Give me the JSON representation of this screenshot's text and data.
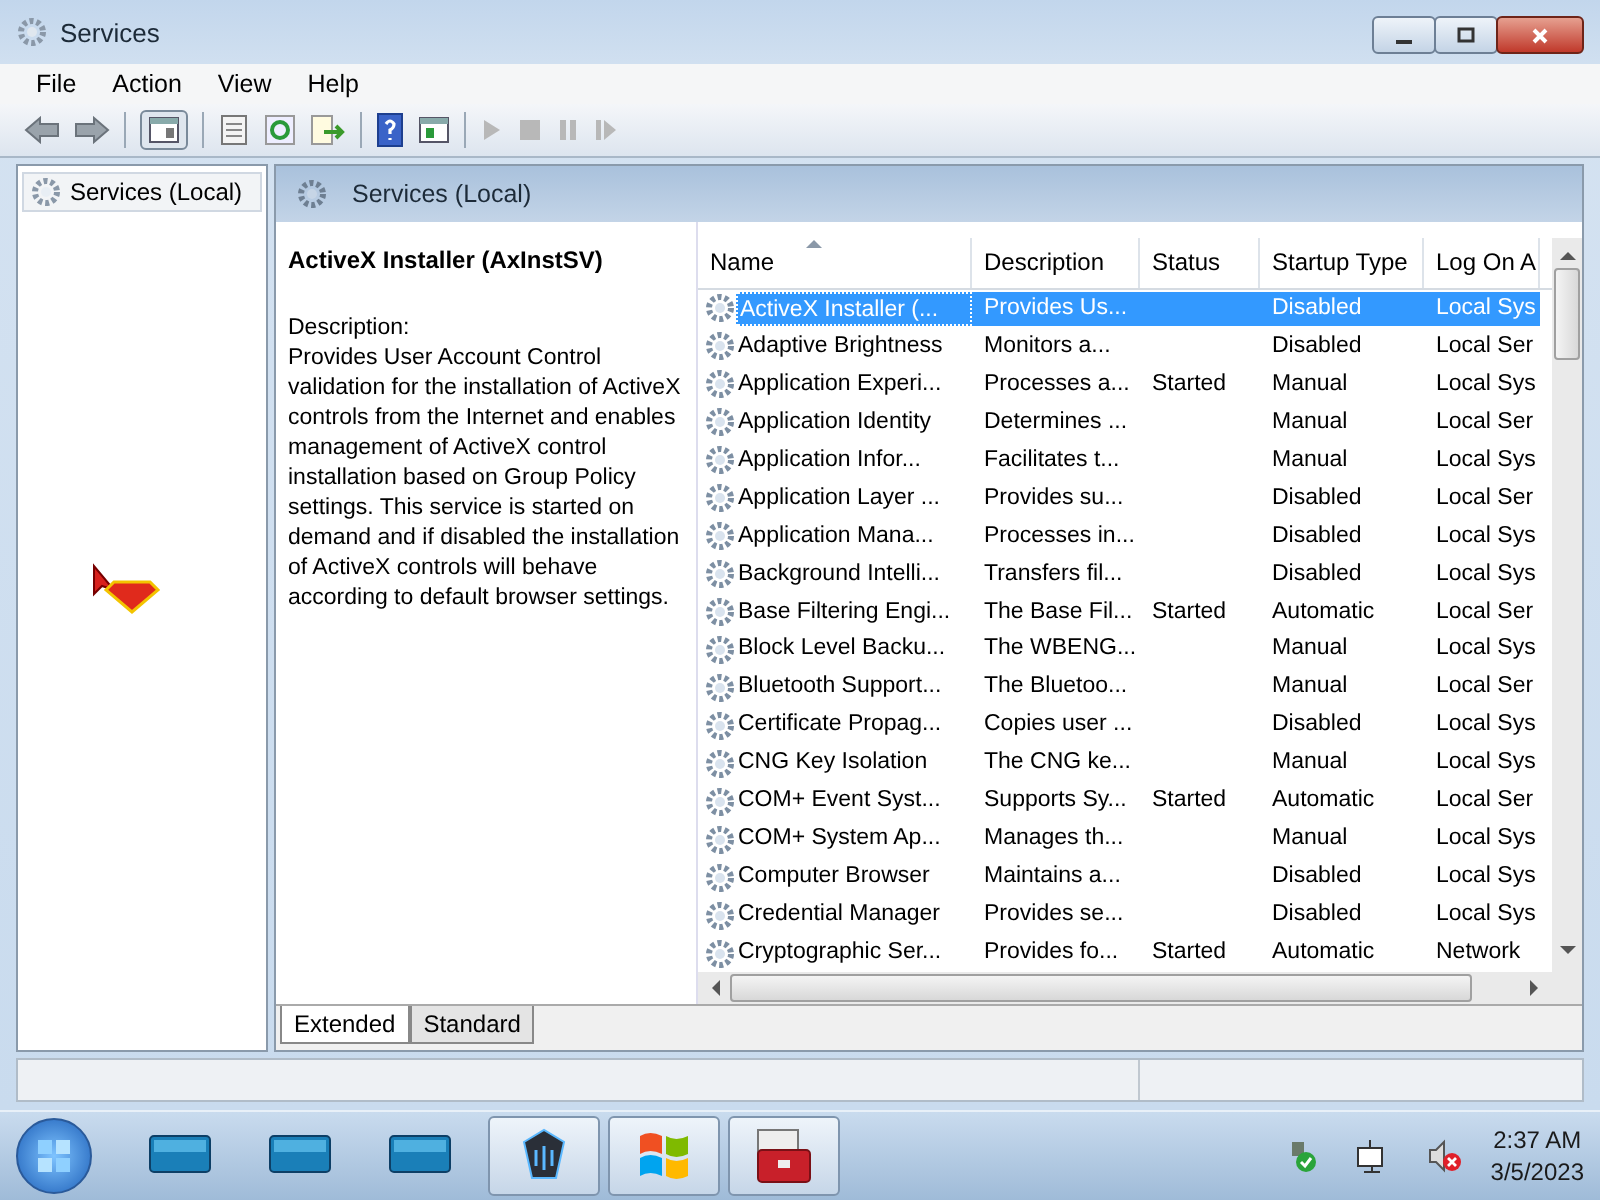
{
  "window": {
    "title": "Services"
  },
  "menu": [
    "File",
    "Action",
    "View",
    "Help"
  ],
  "tree": {
    "items": [
      {
        "label": "Services (Local)",
        "selected": true
      }
    ]
  },
  "header": {
    "title": "Services (Local)"
  },
  "detail": {
    "title": "ActiveX Installer (AxInstSV)",
    "description_label": "Description:",
    "description": "Provides User Account Control validation for the installation of ActiveX controls from the Internet and enables management of ActiveX control installation based on Group Policy settings. This service is started on demand and if disabled the installation of ActiveX controls will behave according to default browser settings."
  },
  "table": {
    "columns": [
      {
        "label": "Name",
        "sorted": true
      },
      {
        "label": "Description",
        "sorted": false
      },
      {
        "label": "Status",
        "sorted": false
      },
      {
        "label": "Startup Type",
        "sorted": false
      },
      {
        "label": "Log On A",
        "sorted": false
      }
    ],
    "rows": [
      {
        "name": "ActiveX Installer (...",
        "description": "Provides Us...",
        "status": "",
        "startup_type": "Disabled",
        "log_on_as": "Local Sys",
        "selected": true
      },
      {
        "name": "Adaptive Brightness",
        "description": "Monitors a...",
        "status": "",
        "startup_type": "Disabled",
        "log_on_as": "Local Ser",
        "selected": false
      },
      {
        "name": "Application Experi...",
        "description": "Processes a...",
        "status": "Started",
        "startup_type": "Manual",
        "log_on_as": "Local Sys",
        "selected": false
      },
      {
        "name": "Application Identity",
        "description": "Determines ...",
        "status": "",
        "startup_type": "Manual",
        "log_on_as": "Local Ser",
        "selected": false
      },
      {
        "name": "Application Infor...",
        "description": "Facilitates t...",
        "status": "",
        "startup_type": "Manual",
        "log_on_as": "Local Sys",
        "selected": false
      },
      {
        "name": "Application Layer ...",
        "description": "Provides su...",
        "status": "",
        "startup_type": "Disabled",
        "log_on_as": "Local Ser",
        "selected": false
      },
      {
        "name": "Application Mana...",
        "description": "Processes in...",
        "status": "",
        "startup_type": "Disabled",
        "log_on_as": "Local Sys",
        "selected": false
      },
      {
        "name": "Background Intelli...",
        "description": "Transfers fil...",
        "status": "",
        "startup_type": "Disabled",
        "log_on_as": "Local Sys",
        "selected": false
      },
      {
        "name": "Base Filtering Engi...",
        "description": "The Base Fil...",
        "status": "Started",
        "startup_type": "Automatic",
        "log_on_as": "Local Ser",
        "selected": false
      },
      {
        "name": "Block Level Backu...",
        "description": "The WBENG...",
        "status": "",
        "startup_type": "Manual",
        "log_on_as": "Local Sys",
        "selected": false
      },
      {
        "name": "Bluetooth Support...",
        "description": "The Bluetoo...",
        "status": "",
        "startup_type": "Manual",
        "log_on_as": "Local Ser",
        "selected": false
      },
      {
        "name": "Certificate Propag...",
        "description": "Copies user ...",
        "status": "",
        "startup_type": "Disabled",
        "log_on_as": "Local Sys",
        "selected": false
      },
      {
        "name": "CNG Key Isolation",
        "description": "The CNG ke...",
        "status": "",
        "startup_type": "Manual",
        "log_on_as": "Local Sys",
        "selected": false
      },
      {
        "name": "COM+ Event Syst...",
        "description": "Supports Sy...",
        "status": "Started",
        "startup_type": "Automatic",
        "log_on_as": "Local Ser",
        "selected": false
      },
      {
        "name": "COM+ System Ap...",
        "description": "Manages th...",
        "status": "",
        "startup_type": "Manual",
        "log_on_as": "Local Sys",
        "selected": false
      },
      {
        "name": "Computer Browser",
        "description": "Maintains a...",
        "status": "",
        "startup_type": "Disabled",
        "log_on_as": "Local Sys",
        "selected": false
      },
      {
        "name": "Credential Manager",
        "description": "Provides se...",
        "status": "",
        "startup_type": "Disabled",
        "log_on_as": "Local Sys",
        "selected": false
      },
      {
        "name": "Cryptographic Ser...",
        "description": "Provides fo...",
        "status": "Started",
        "startup_type": "Automatic",
        "log_on_as": "Network",
        "selected": false
      }
    ]
  },
  "view_tabs": [
    {
      "label": "Extended",
      "selected": true
    },
    {
      "label": "Standard",
      "selected": false
    }
  ],
  "taskbar": {
    "time": "2:37 AM",
    "date": "3/5/2023"
  }
}
